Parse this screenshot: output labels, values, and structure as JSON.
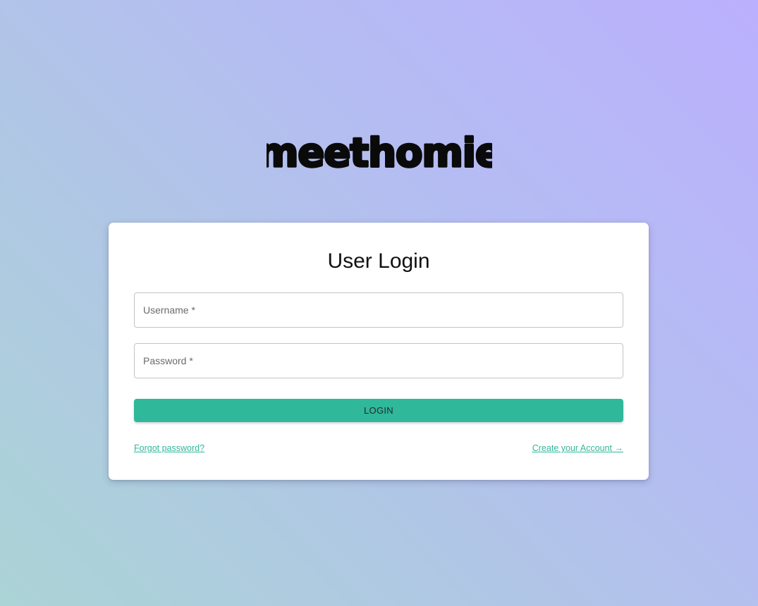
{
  "brand": {
    "logo_text": "meethomie"
  },
  "login_card": {
    "title": "User Login",
    "username": {
      "placeholder": "Username *",
      "value": ""
    },
    "password": {
      "placeholder": "Password *",
      "value": ""
    },
    "login_button_label": "LOGIN",
    "forgot_password_link": "Forgot password?",
    "create_account_link": "Create your Account →"
  },
  "colors": {
    "accent": "#2fb89a",
    "card_background": "#ffffff",
    "gradient_top_right": "#bbb0fd",
    "gradient_bottom_left": "#abd4d6"
  }
}
